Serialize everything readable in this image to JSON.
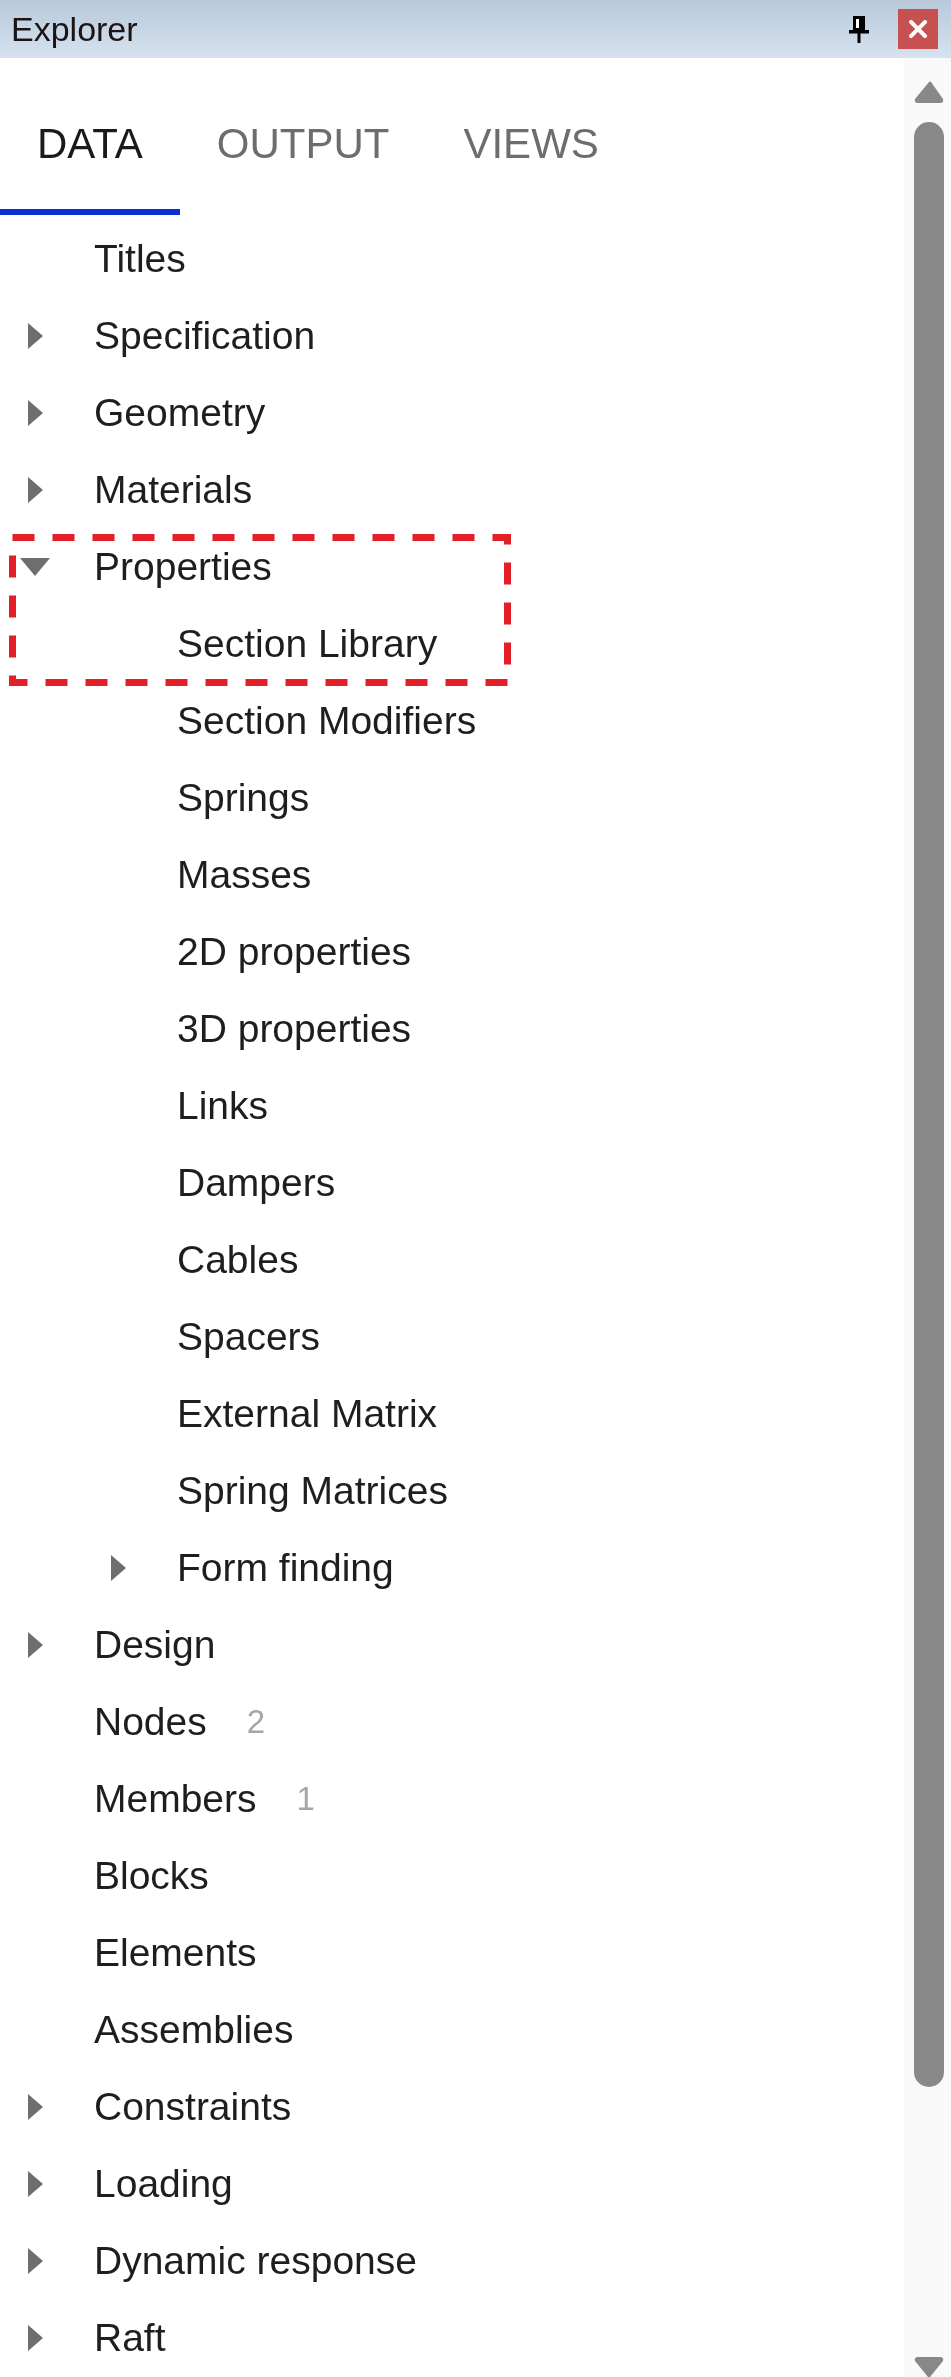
{
  "window": {
    "title": "Explorer"
  },
  "tabs": [
    {
      "label": "DATA",
      "selected": true
    },
    {
      "label": "OUTPUT",
      "selected": false
    },
    {
      "label": "VIEWS",
      "selected": false
    }
  ],
  "tree": [
    {
      "label": "Titles",
      "kind": "leaf",
      "highlighted": false
    },
    {
      "label": "Specification",
      "kind": "group",
      "expanded": false,
      "highlighted": false
    },
    {
      "label": "Geometry",
      "kind": "group",
      "expanded": false,
      "highlighted": false
    },
    {
      "label": "Materials",
      "kind": "group",
      "expanded": false,
      "highlighted": false
    },
    {
      "label": "Properties",
      "kind": "group",
      "expanded": true,
      "highlighted": true,
      "children": [
        {
          "label": "Section Library",
          "kind": "leaf",
          "highlighted": true
        },
        {
          "label": "Section Modifiers",
          "kind": "leaf",
          "highlighted": false
        },
        {
          "label": "Springs",
          "kind": "leaf",
          "highlighted": false
        },
        {
          "label": "Masses",
          "kind": "leaf",
          "highlighted": false
        },
        {
          "label": "2D properties",
          "kind": "leaf",
          "highlighted": false
        },
        {
          "label": "3D properties",
          "kind": "leaf",
          "highlighted": false
        },
        {
          "label": "Links",
          "kind": "leaf",
          "highlighted": false
        },
        {
          "label": "Dampers",
          "kind": "leaf",
          "highlighted": false
        },
        {
          "label": "Cables",
          "kind": "leaf",
          "highlighted": false
        },
        {
          "label": "Spacers",
          "kind": "leaf",
          "highlighted": false
        },
        {
          "label": "External Matrix",
          "kind": "leaf",
          "highlighted": false
        },
        {
          "label": "Spring Matrices",
          "kind": "leaf",
          "highlighted": false
        },
        {
          "label": "Form finding",
          "kind": "group",
          "expanded": false,
          "highlighted": false
        }
      ]
    },
    {
      "label": "Design",
      "kind": "group",
      "expanded": false,
      "highlighted": false
    },
    {
      "label": "Nodes",
      "kind": "leaf",
      "count": "2",
      "highlighted": false
    },
    {
      "label": "Members",
      "kind": "leaf",
      "count": "1",
      "highlighted": false
    },
    {
      "label": "Blocks",
      "kind": "leaf",
      "highlighted": false
    },
    {
      "label": "Elements",
      "kind": "leaf",
      "highlighted": false
    },
    {
      "label": "Assemblies",
      "kind": "leaf",
      "highlighted": false
    },
    {
      "label": "Constraints",
      "kind": "group",
      "expanded": false,
      "highlighted": false
    },
    {
      "label": "Loading",
      "kind": "group",
      "expanded": false,
      "highlighted": false
    },
    {
      "label": "Dynamic response",
      "kind": "group",
      "expanded": false,
      "highlighted": false
    },
    {
      "label": "Raft",
      "kind": "group",
      "expanded": false,
      "highlighted": false
    }
  ]
}
